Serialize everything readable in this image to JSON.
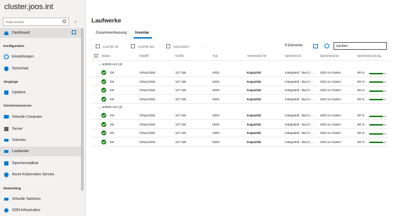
{
  "app": {
    "title": "cluster.joos.int"
  },
  "search": {
    "placeholder": "Tools suchen"
  },
  "nav": {
    "dashboard": "Dashboard",
    "sections": {
      "konfig": "Konfiguration",
      "vorgaenge": "Vorgänge",
      "cluster": "Clusterressourcen",
      "networking": "Networking"
    },
    "items": {
      "einstellungen": "Einstellungen",
      "sicherheit": "Sicherheit",
      "updates": "Updates",
      "vm": "Virtuelle Computer",
      "server": "Server",
      "volumes": "Volumes",
      "laufwerke": "Laufwerke",
      "speicherreplikat": "Speicherreplikat",
      "aks": "Azure Kubernetes Service",
      "switches": "Virtuelle Switches",
      "sdn": "SDN-Infrastruktur"
    }
  },
  "main": {
    "title": "Laufwerke",
    "tabs": [
      "Zusammenfassung",
      "Inventar"
    ],
    "toolbar": {
      "light_on": "Leuchte ein",
      "light_off": "Leuchte aus",
      "remove": "Ausmustern",
      "more": "···",
      "count": "8 Elemente",
      "search_value": "suchen"
    },
    "columns": [
      "Status",
      "Modell",
      "Größe",
      "Typ",
      "Verwendet für",
      "Speicherort",
      "Speicherpool",
      "Speichernutzung"
    ],
    "groups": [
      {
        "label": "w2k25-ce1 (4)",
        "rows": [
          {
            "status": "OK",
            "model": "Virtual Disk",
            "size": "127 GB",
            "type": "HDD",
            "used": "Kapazität",
            "location": "Integrated : Bus 0 ...",
            "pool": "S2D on cluster",
            "usage": "80 %",
            "pct": 0.8
          },
          {
            "status": "OK",
            "model": "Virtual Disk",
            "size": "127 GB",
            "type": "HDD",
            "used": "Kapazität",
            "location": "Integrated : Bus 0 ...",
            "pool": "S2D on cluster",
            "usage": "80 %",
            "pct": 0.8
          },
          {
            "status": "OK",
            "model": "Virtual Disk",
            "size": "127 GB",
            "type": "HDD",
            "used": "Kapazität",
            "location": "Integrated : Bus 0 ...",
            "pool": "S2D on cluster",
            "usage": "80 %",
            "pct": 0.8
          },
          {
            "status": "OK",
            "model": "Virtual Disk",
            "size": "127 GB",
            "type": "HDD",
            "used": "Kapazität",
            "location": "Integrated : Bus 0 ...",
            "pool": "S2D on cluster",
            "usage": "80 %",
            "pct": 0.8
          }
        ]
      },
      {
        "label": "w2k25-ce2 (4)",
        "rows": [
          {
            "status": "OK",
            "model": "Virtual Disk",
            "size": "127 GB",
            "type": "HDD",
            "used": "Kapazität",
            "location": "Integrated : Bus 0 ...",
            "pool": "S2D on cluster",
            "usage": "80 %",
            "pct": 0.8
          },
          {
            "status": "OK",
            "model": "Virtual Disk",
            "size": "127 GB",
            "type": "HDD",
            "used": "Kapazität",
            "location": "Integrated : Bus 0 ...",
            "pool": "S2D on cluster",
            "usage": "80 %",
            "pct": 0.8
          },
          {
            "status": "OK",
            "model": "Virtual Disk",
            "size": "127 GB",
            "type": "HDD",
            "used": "Kapazität",
            "location": "Integrated : Bus 0 ...",
            "pool": "S2D on cluster",
            "usage": "80 %",
            "pct": 0.8
          },
          {
            "status": "OK",
            "model": "Virtual Disk",
            "size": "127 GB",
            "type": "HDD",
            "used": "Kapazität",
            "location": "Integrated : Bus 0 ...",
            "pool": "S2D on cluster",
            "usage": "80 %",
            "pct": 0.8
          }
        ]
      }
    ]
  },
  "colors": {
    "accent": "#0078d4",
    "ok": "#107c10"
  }
}
